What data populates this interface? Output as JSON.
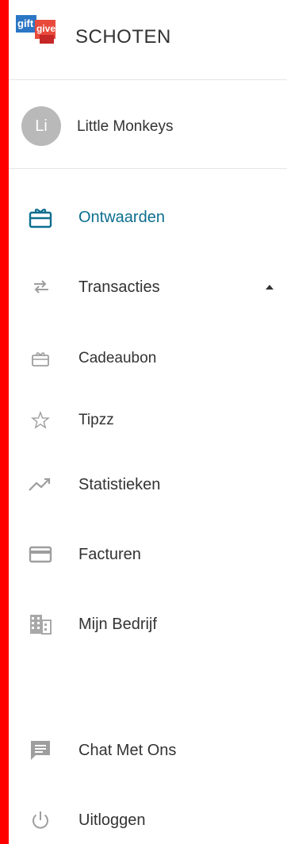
{
  "header": {
    "logo_text_top": "gift",
    "logo_text_bottom": "give",
    "logo_sub": "",
    "title": "SCHOTEN"
  },
  "profile": {
    "initials": "Li",
    "name": "Little Monkeys"
  },
  "menu": {
    "items": [
      {
        "label": "Ontwaarden",
        "icon": "gift-card-icon",
        "active": true
      },
      {
        "label": "Transacties",
        "icon": "swap-arrows-icon",
        "expanded": true
      },
      {
        "label": "Cadeaubon",
        "icon": "gift-card-icon"
      },
      {
        "label": "Tipzz",
        "icon": "star-icon"
      },
      {
        "label": "Statistieken",
        "icon": "trending-up-icon"
      },
      {
        "label": "Facturen",
        "icon": "credit-card-icon"
      },
      {
        "label": "Mijn Bedrijf",
        "icon": "building-icon"
      },
      {
        "label": "Chat Met Ons",
        "icon": "chat-icon"
      },
      {
        "label": "Uitloggen",
        "icon": "power-icon"
      }
    ]
  },
  "colors": {
    "accent": "#0d6e8f",
    "frame": "#ff0000",
    "icon_gray": "#9e9e9e"
  }
}
